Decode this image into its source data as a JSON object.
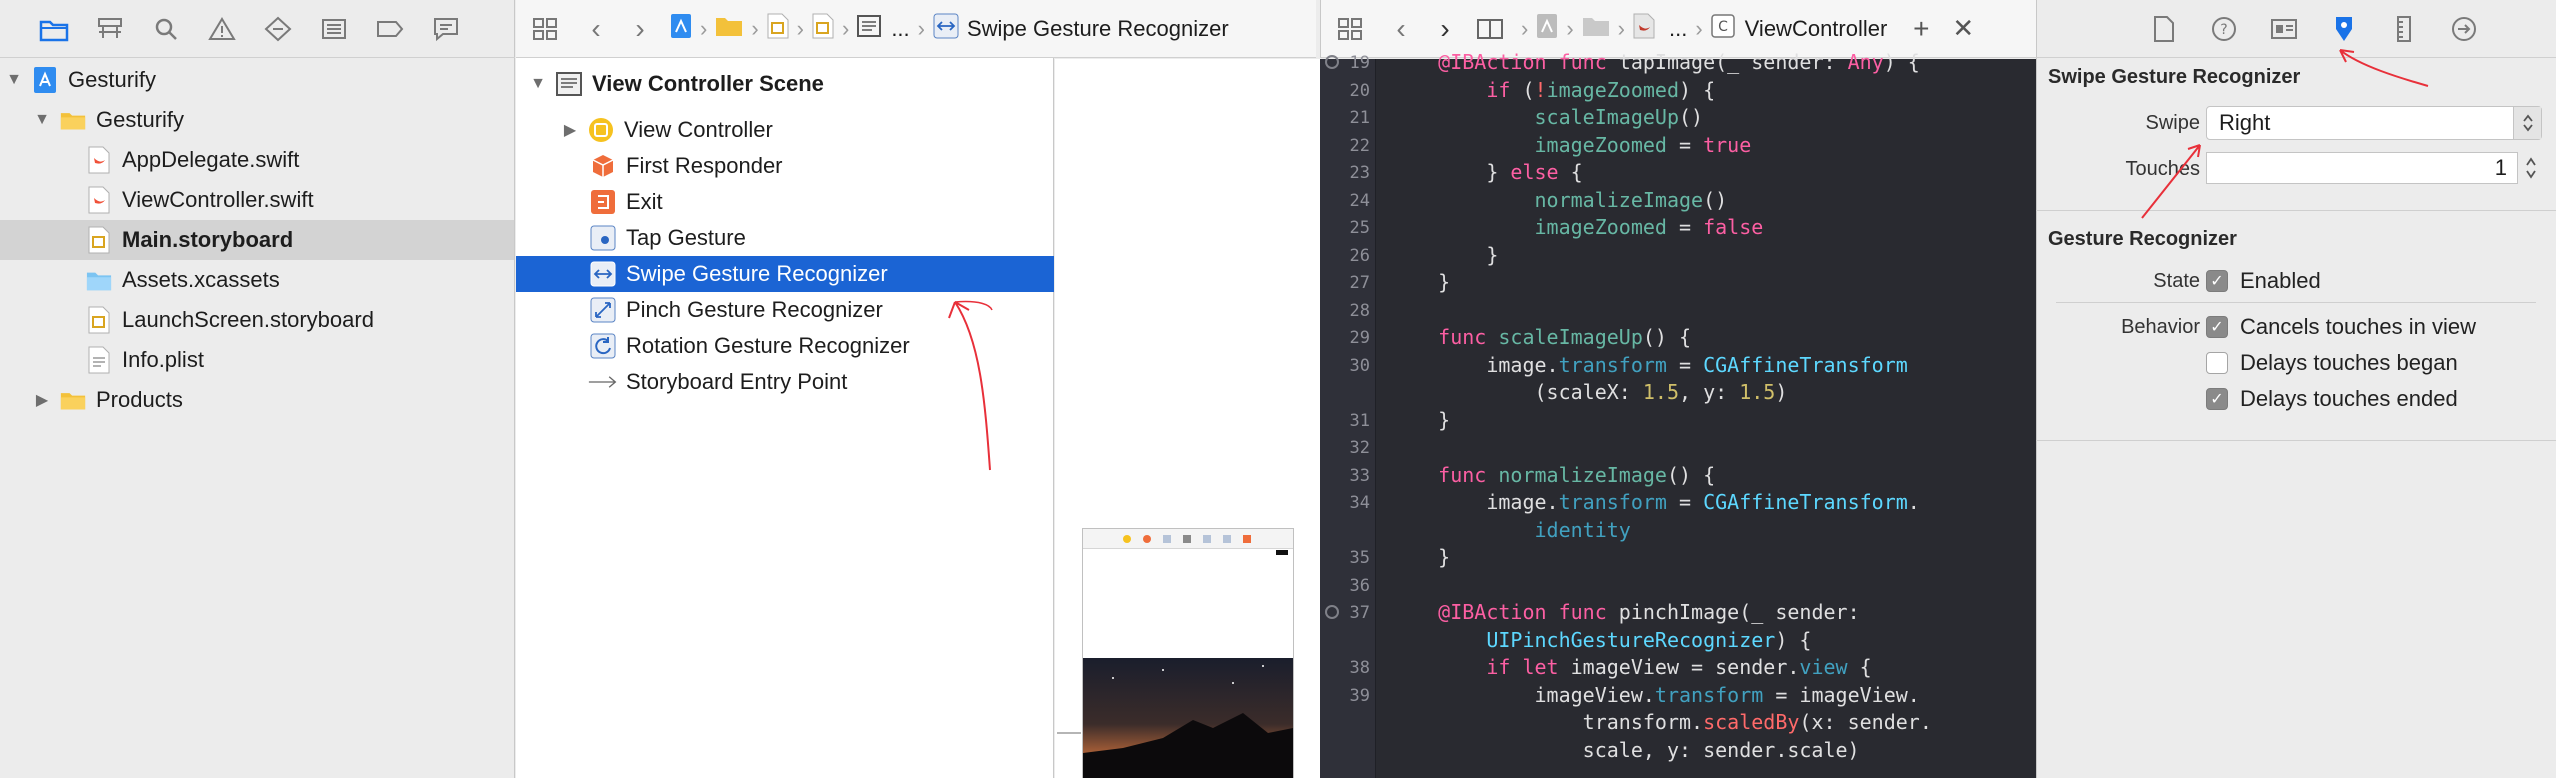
{
  "navigator": {
    "items": [
      {
        "label": "Gesturify",
        "kind": "project"
      },
      {
        "label": "Gesturify",
        "kind": "group"
      },
      {
        "label": "AppDelegate.swift",
        "kind": "swift"
      },
      {
        "label": "ViewController.swift",
        "kind": "swift"
      },
      {
        "label": "Main.storyboard",
        "kind": "storyboard"
      },
      {
        "label": "Assets.xcassets",
        "kind": "assets"
      },
      {
        "label": "LaunchScreen.storyboard",
        "kind": "storyboard"
      },
      {
        "label": "Info.plist",
        "kind": "plist"
      },
      {
        "label": "Products",
        "kind": "group"
      }
    ],
    "selected": "Main.storyboard"
  },
  "jump_bar_1": {
    "ellipsis": "...",
    "current": "Swipe Gesture Recognizer"
  },
  "jump_bar_2": {
    "ellipsis": "...",
    "current": "ViewController"
  },
  "outline": {
    "scene_title": "View Controller Scene",
    "items": [
      {
        "label": "View Controller"
      },
      {
        "label": "First Responder"
      },
      {
        "label": "Exit"
      },
      {
        "label": "Tap Gesture"
      },
      {
        "label": "Swipe Gesture Recognizer"
      },
      {
        "label": "Pinch Gesture Recognizer"
      },
      {
        "label": "Rotation Gesture Recognizer"
      },
      {
        "label": "Storyboard Entry Point"
      }
    ],
    "selected": "Swipe Gesture Recognizer"
  },
  "code": {
    "lines": [
      {
        "n": "19",
        "text": "    @IBAction func tapImage(_ sender: Any) {"
      },
      {
        "n": "20",
        "text": "        if (!imageZoomed) {"
      },
      {
        "n": "21",
        "text": "            scaleImageUp()"
      },
      {
        "n": "22",
        "text": "            imageZoomed = true"
      },
      {
        "n": "23",
        "text": "        } else {"
      },
      {
        "n": "24",
        "text": "            normalizeImage()"
      },
      {
        "n": "25",
        "text": "            imageZoomed = false"
      },
      {
        "n": "26",
        "text": "        }"
      },
      {
        "n": "27",
        "text": "    }"
      },
      {
        "n": "28",
        "text": ""
      },
      {
        "n": "29",
        "text": "    func scaleImageUp() {"
      },
      {
        "n": "30",
        "text": "        image.transform = CGAffineTransform"
      },
      {
        "n": "",
        "text": "            (scaleX: 1.5, y: 1.5)"
      },
      {
        "n": "31",
        "text": "    }"
      },
      {
        "n": "32",
        "text": ""
      },
      {
        "n": "33",
        "text": "    func normalizeImage() {"
      },
      {
        "n": "34",
        "text": "        image.transform = CGAffineTransform."
      },
      {
        "n": "",
        "text": "            identity"
      },
      {
        "n": "35",
        "text": "    }"
      },
      {
        "n": "36",
        "text": ""
      },
      {
        "n": "37",
        "text": "    @IBAction func pinchImage(_ sender:"
      },
      {
        "n": "",
        "text": "        UIPinchGestureRecognizer) {"
      },
      {
        "n": "38",
        "text": "        if let imageView = sender.view {"
      },
      {
        "n": "39",
        "text": "            imageView.transform = imageView."
      },
      {
        "n": "",
        "text": "                transform.scaledBy(x: sender."
      },
      {
        "n": "",
        "text": "                scale, y: sender.scale)"
      }
    ]
  },
  "inspector": {
    "section1_title": "Swipe Gesture Recognizer",
    "swipe_label": "Swipe",
    "swipe_value": "Right",
    "touches_label": "Touches",
    "touches_value": "1",
    "section2_title": "Gesture Recognizer",
    "state_label": "State",
    "enabled_label": "Enabled",
    "behavior_label": "Behavior",
    "checkboxes": [
      {
        "label": "Enabled",
        "checked": true
      },
      {
        "label": "Cancels touches in view",
        "checked": true
      },
      {
        "label": "Delays touches began",
        "checked": false
      },
      {
        "label": "Delays touches ended",
        "checked": true
      }
    ]
  },
  "colors": {
    "selection_blue": "#1b64d4",
    "inspector_accent": "#1a73e8",
    "editor_bg": "#292a30",
    "annotation_red": "#e8303a"
  }
}
